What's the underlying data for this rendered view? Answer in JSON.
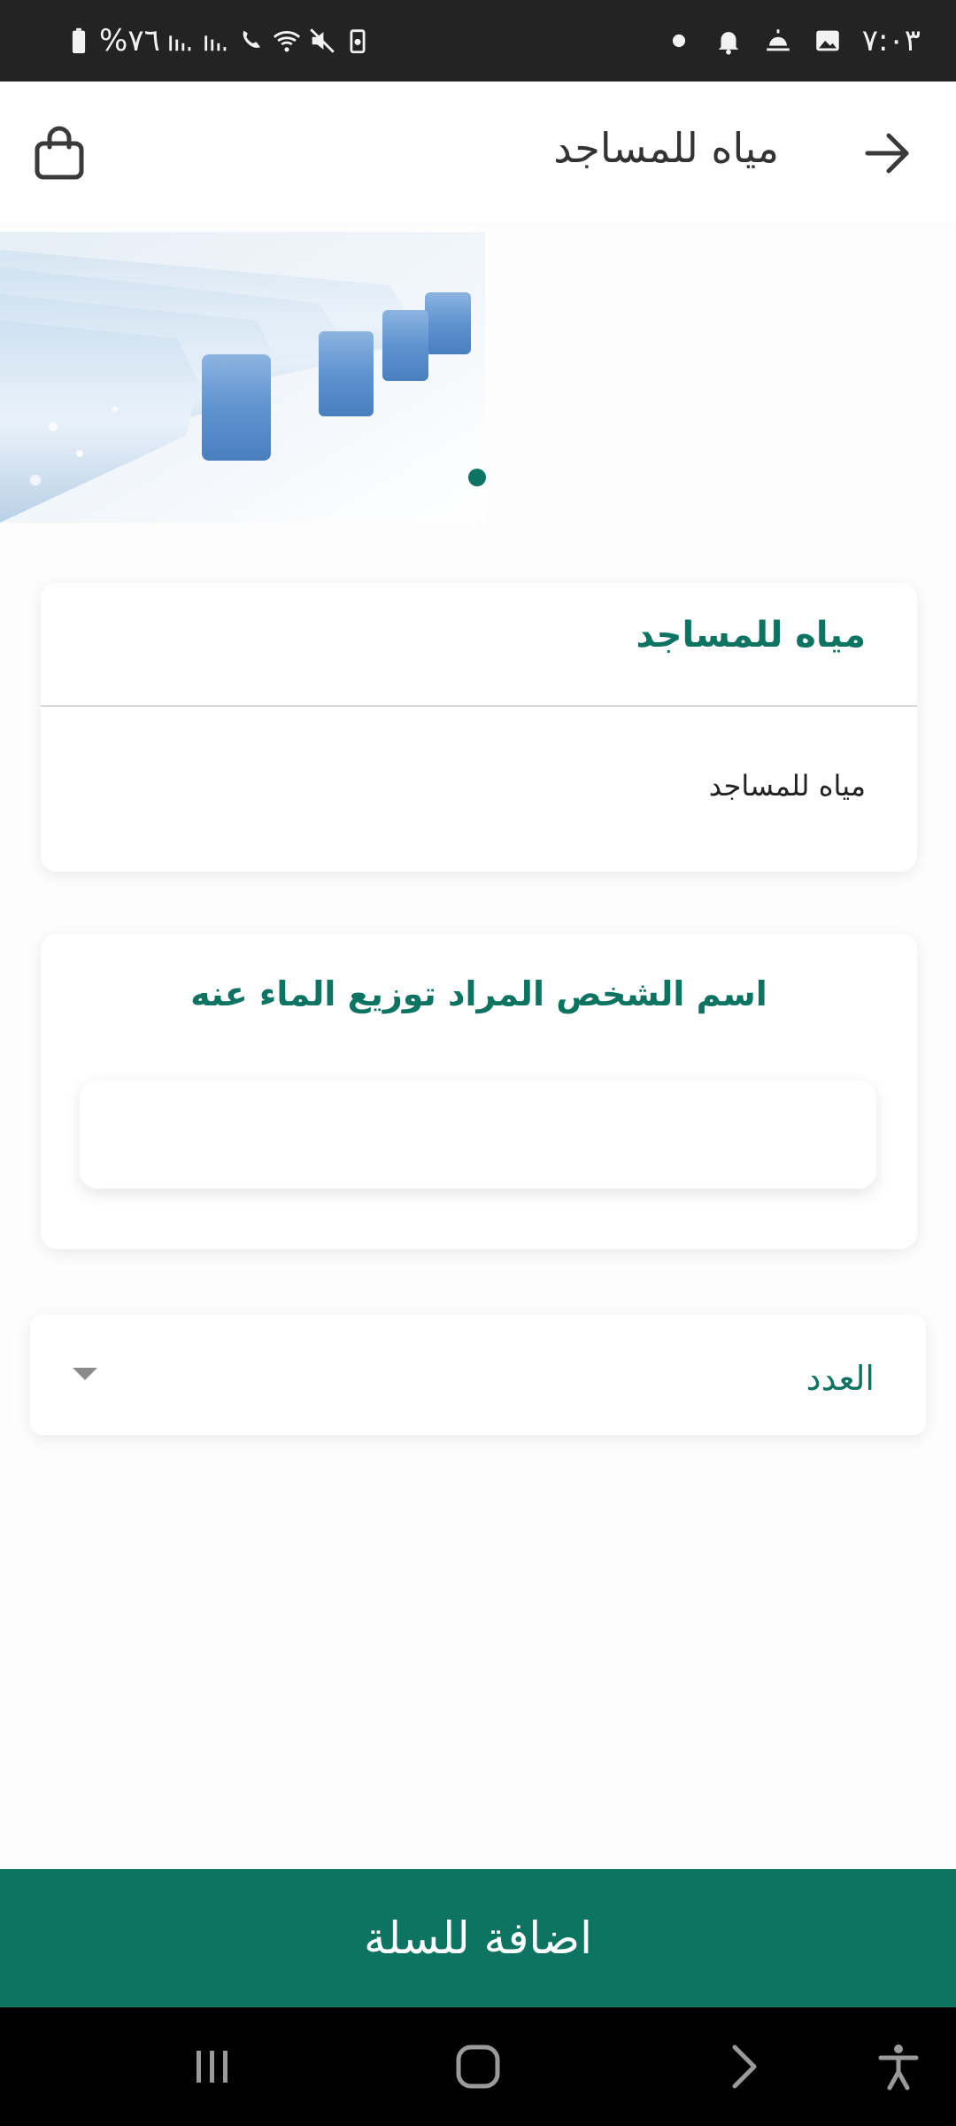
{
  "status_bar": {
    "time": "٧:٠٣",
    "battery": "%٧٦"
  },
  "header": {
    "title": "مياه للمساجد"
  },
  "product": {
    "title": "مياه للمساجد",
    "description": "مياه للمساجد"
  },
  "recipient": {
    "label": "اسم الشخص المراد توزيع الماء عنه",
    "value": ""
  },
  "quantity": {
    "label": "العدد"
  },
  "actions": {
    "add_to_cart": "اضافة للسلة"
  },
  "carousel": {
    "slide_count": 1,
    "active_index": 0
  },
  "colors": {
    "accent": "#0e7462",
    "status_bar": "#232323",
    "nav_bar": "#000000"
  },
  "icons": {
    "back": "arrow-right-icon",
    "cart": "shopping-bag-icon",
    "dropdown": "chevron-down-icon"
  }
}
